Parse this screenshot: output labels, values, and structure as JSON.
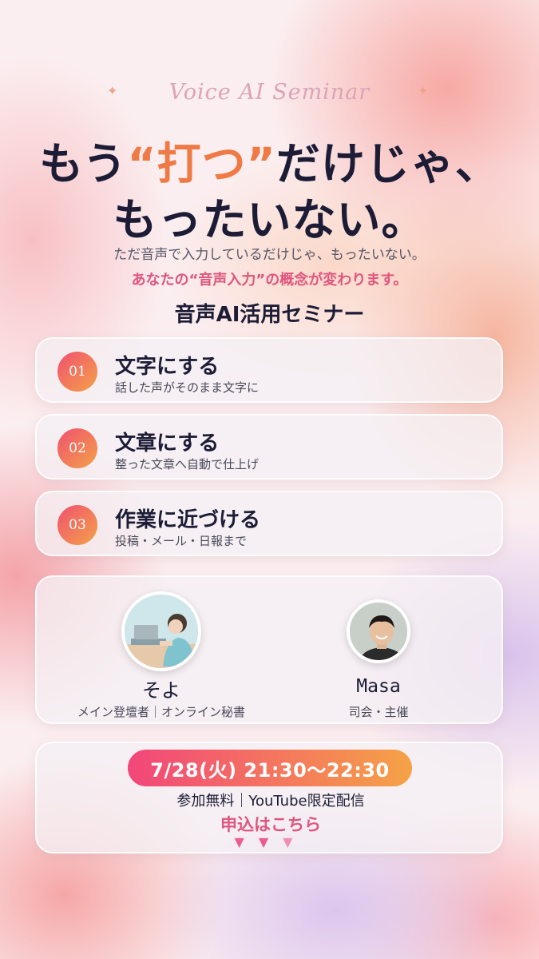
{
  "header": {
    "eyebrow": "Voice AI Seminar",
    "headline_line1_part1": "もう",
    "headline_line1_accent": "“打つ”",
    "headline_line1_part2": "だけじゃ、",
    "headline_line2": "もったいない。",
    "subline": "ただ音声で入力しているだけじゃ、もったいない。",
    "subline_accent": "あなたの“音声入力”の概念が変わります。",
    "seminar_title": "音声AI活用セミナー"
  },
  "features": [
    {
      "number": "01",
      "title": "文字にする",
      "subtitle": "話した声がそのまま文字に"
    },
    {
      "number": "02",
      "title": "文章にする",
      "subtitle": "整った文章へ自動で仕上げ"
    },
    {
      "number": "03",
      "title": "作業に近づける",
      "subtitle": "投稿・メール・日報まで"
    }
  ],
  "speakers": [
    {
      "name": "そよ",
      "role": "メイン登壇者｜オンライン秘書"
    },
    {
      "name": "Masa",
      "role": "司会・主催"
    }
  ],
  "event": {
    "datetime": "7/28(火) 21:30〜22:30",
    "info": "参加無料｜YouTube限定配信",
    "cta": "申込はこちら",
    "arrows": "▼▼▼"
  },
  "colors": {
    "accent_orange": "#f07a45",
    "accent_pink": "#e0557e",
    "gradient_start": "#f2467a",
    "gradient_end": "#f5a246"
  },
  "icons": {
    "sparkle": "sparkle-icon",
    "arrow": "down-triangle-icon"
  }
}
